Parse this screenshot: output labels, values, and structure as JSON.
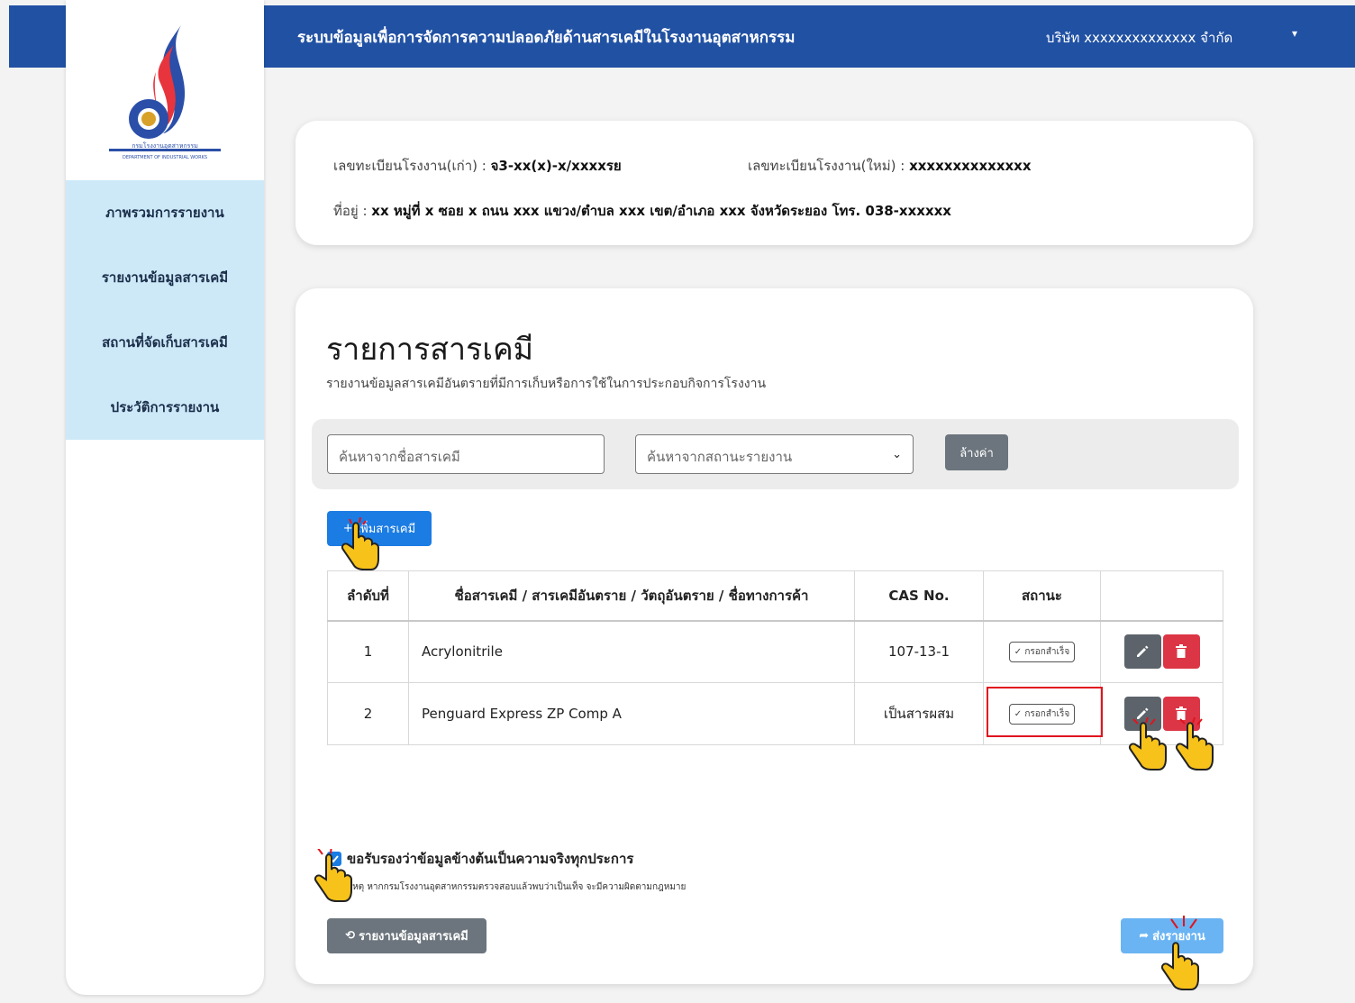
{
  "header": {
    "title": "ระบบข้อมูลเพื่อการจัดการความปลอดภัยด้านสารเคมีในโรงงานอุตสาหกรรม",
    "company": "บริษัท xxxxxxxxxxxxxx จำกัด",
    "caret": "▾"
  },
  "sidebar": {
    "logo_text": "กรมโรงงานอุตสาหกรรม",
    "items": [
      {
        "label": "ภาพรวมการรายงาน"
      },
      {
        "label": "รายงานข้อมูลสารเคมี"
      },
      {
        "label": "สถานที่จัดเก็บสารเคมี"
      },
      {
        "label": "ประวัติการรายงาน"
      }
    ]
  },
  "info": {
    "old_reg_label": "เลขทะเบียนโรงงาน(เก่า) :",
    "old_reg_value": "จ3-xx(x)-x/xxxxรย",
    "new_reg_label": "เลขทะเบียนโรงงาน(ใหม่) :",
    "new_reg_value": "xxxxxxxxxxxxxx",
    "address_label": "ที่อยู่ :",
    "address_value": "xx หมู่ที่ x ซอย x ถนน xxx แขวง/ตำบล xxx เขต/อำเภอ xxx จังหวัดระยอง โทร. 038-xxxxxx"
  },
  "main": {
    "title": "รายการสารเคมี",
    "subtitle": "รายงานข้อมูลสารเคมีอันตรายที่มีการเก็บหรือการใช้ในการประกอบกิจการโรงงาน",
    "search_placeholder": "ค้นหาจากชื่อสารเคมี",
    "status_select": "ค้นหาจากสถานะรายงาน",
    "clear_label": "ล้างค่า",
    "add_label": "เพิ่มสารเคมี",
    "table": {
      "headers": [
        "ลำดับที่",
        "ชื่อสารเคมี / สารเคมีอันตราย / วัตถุอันตราย / ชื่อทางการค้า",
        "CAS No.",
        "สถานะ",
        ""
      ],
      "rows": [
        {
          "no": "1",
          "name": "Acrylonitrile",
          "cas": "107-13-1",
          "status": "กรอกสำเร็จ"
        },
        {
          "no": "2",
          "name": "Penguard Express ZP Comp A",
          "cas": "เป็นสารผสม",
          "status": "กรอกสำเร็จ"
        }
      ]
    },
    "certify_label": "ขอรับรองว่าข้อมูลข้างต้นเป็นความจริงทุกประการ",
    "certify_checked": true,
    "note": "หมายเหตุ หากกรมโรงงานอุตสาหกรรมตรวจสอบแล้วพบว่าเป็นเท็จ จะมีความผิดตามกฎหมาย",
    "back_label": "รายงานข้อมูลสารเคมี",
    "send_label": "ส่งรายงาน"
  },
  "colors": {
    "header_bg": "#2151a3",
    "nav_bg": "#cde9f8",
    "primary": "#1b7ce3",
    "danger": "#dc3545",
    "secondary": "#6c757d",
    "highlight": "#e0141e"
  }
}
